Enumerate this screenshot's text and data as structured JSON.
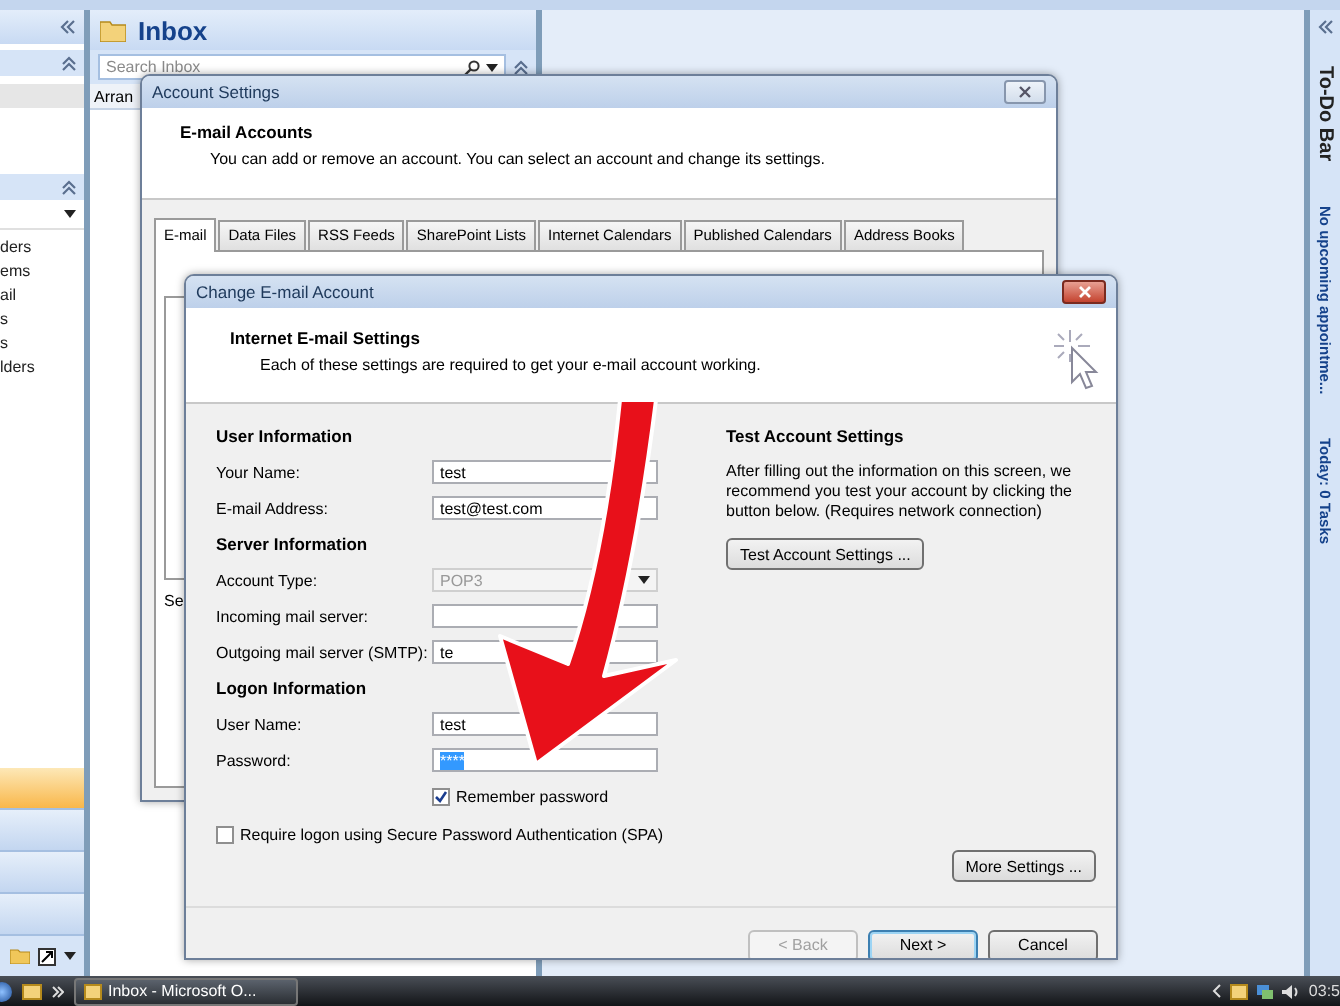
{
  "outlook": {
    "navigation_pane": {
      "items": [
        "ders",
        "ems",
        "ail",
        "s",
        "s",
        "lders"
      ]
    },
    "inbox": {
      "title": "Inbox",
      "search": {
        "placeholder": "Search Inbox"
      },
      "arrange_label": "Arran"
    },
    "todo_bar": {
      "title": "To-Do Bar",
      "appointments": "No upcoming appointme...",
      "tasks": "Today: 0 Tasks"
    }
  },
  "account_settings": {
    "title": "Account Settings",
    "heading": "E-mail Accounts",
    "description": "You can add or remove an account. You can select an account and change its settings.",
    "tabs": [
      {
        "label": "E-mail",
        "selected": true
      },
      {
        "label": "Data Files",
        "selected": false
      },
      {
        "label": "RSS Feeds",
        "selected": false
      },
      {
        "label": "SharePoint Lists",
        "selected": false
      },
      {
        "label": "Internet Calendars",
        "selected": false
      },
      {
        "label": "Published Calendars",
        "selected": false
      },
      {
        "label": "Address Books",
        "selected": false
      }
    ],
    "section_label": "Se"
  },
  "change_account": {
    "title": "Change E-mail Account",
    "heading": "Internet E-mail Settings",
    "description": "Each of these settings are required to get your e-mail account working.",
    "groups": [
      {
        "heading": "User Information",
        "fields": [
          {
            "label": "Your Name:",
            "value": "test",
            "kind": "text",
            "disabled": false
          },
          {
            "label": "E-mail Address:",
            "value": "test@test.com",
            "kind": "text",
            "disabled": false
          }
        ]
      },
      {
        "heading": "Server Information",
        "fields": [
          {
            "label": "Account Type:",
            "value": "POP3",
            "kind": "select",
            "disabled": true
          },
          {
            "label": "Incoming mail server:",
            "kind": "text",
            "disabled": false
          },
          {
            "label": "Outgoing mail server (SMTP):",
            "value": "te",
            "kind": "text",
            "disabled": false
          }
        ]
      },
      {
        "heading": "Logon Information",
        "fields": [
          {
            "label": "User Name:",
            "value": "test",
            "kind": "text",
            "disabled": false
          },
          {
            "label": "Password:",
            "value": "****",
            "kind": "password",
            "disabled": false,
            "highlighted": true
          }
        ],
        "option": {
          "label": "Remember password",
          "checked": true
        }
      }
    ],
    "spa": {
      "label": "Require logon using Secure Password Authentication (SPA)",
      "checked": false
    },
    "test": {
      "heading": "Test Account Settings",
      "text": "After filling out the information on this screen, we recommend you test your account by clicking the button below. (Requires network connection)",
      "button": "Test Account Settings ..."
    },
    "more_button": "More Settings ...",
    "footer_buttons": [
      {
        "label": "< Back",
        "disabled": true,
        "default": false
      },
      {
        "label": "Next >",
        "disabled": false,
        "default": true
      },
      {
        "label": "Cancel",
        "disabled": false,
        "default": false
      }
    ]
  },
  "taskbar": {
    "window_button": "Inbox - Microsoft O...",
    "clock": "03:5"
  }
}
